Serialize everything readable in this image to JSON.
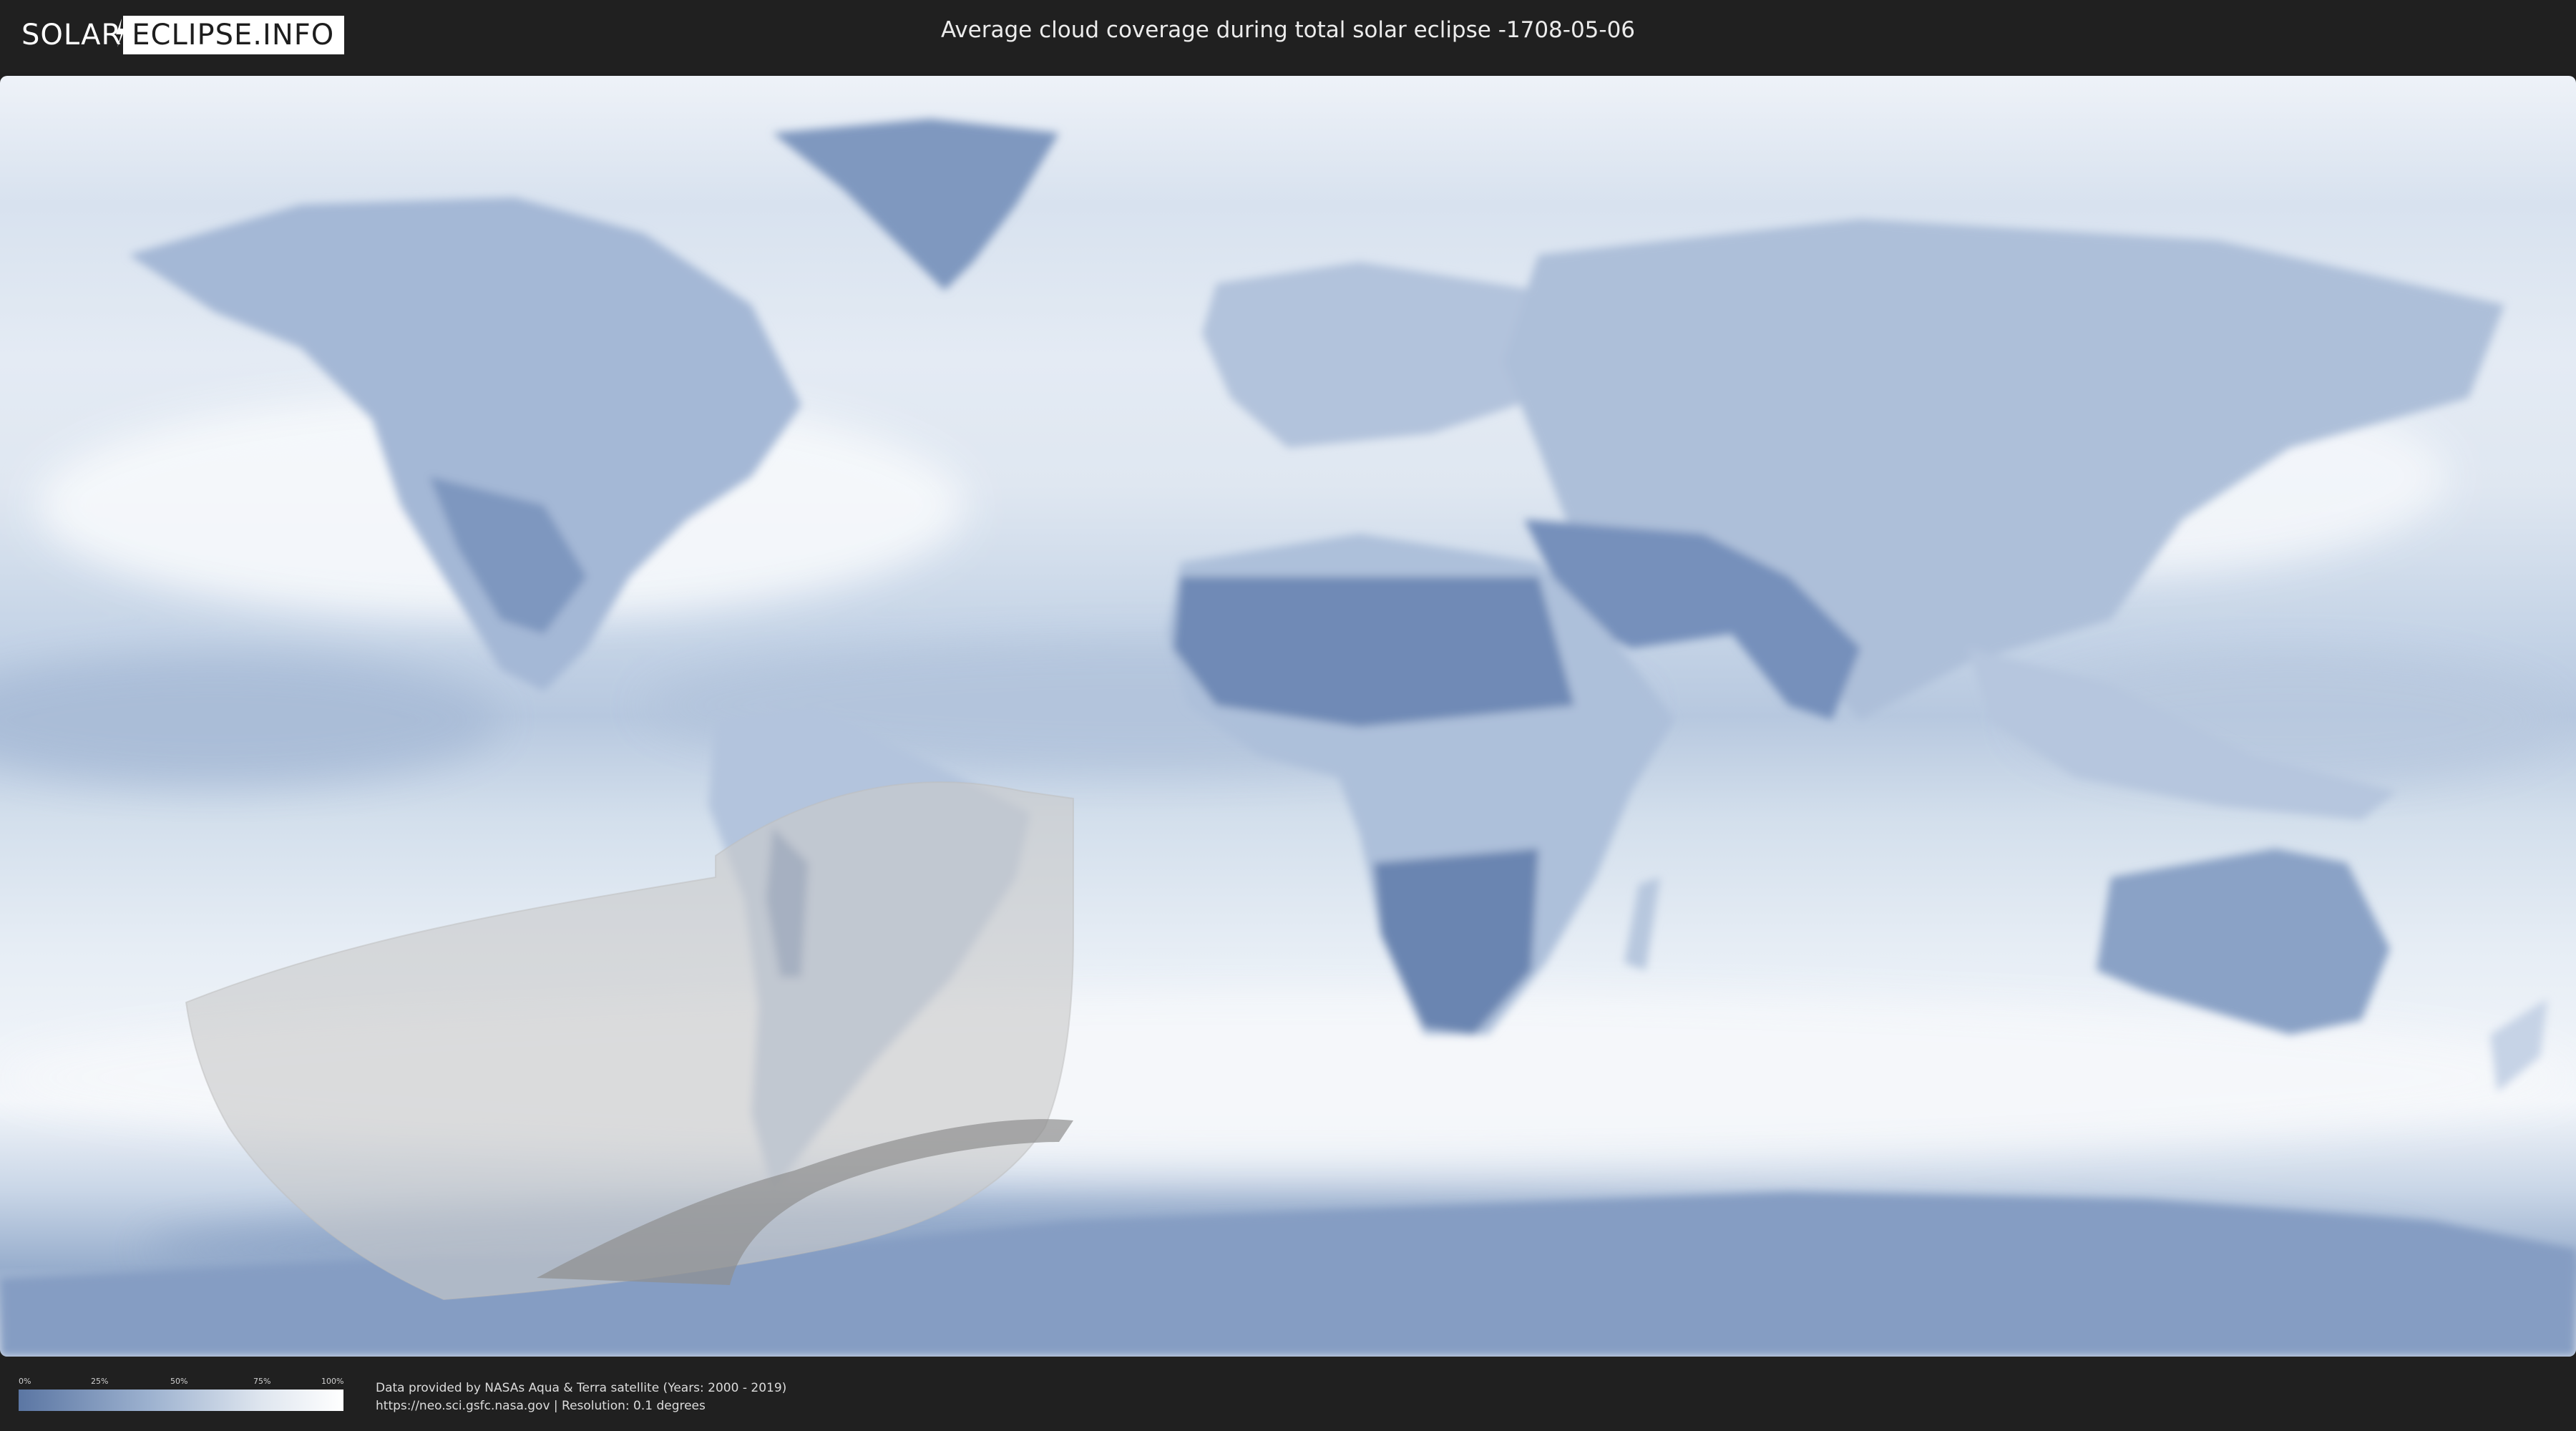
{
  "header": {
    "logo_part1": "SOLAR",
    "logo_part2": "ECLIPSE.INFO",
    "title": "Average cloud coverage during total solar eclipse -1708-05-06"
  },
  "legend": {
    "ticks": [
      "0%",
      "25%",
      "50%",
      "75%",
      "100%"
    ],
    "colors": {
      "low": "#5b76a3",
      "high": "#ffffff"
    }
  },
  "credits": {
    "line1": "Data provided by NASAs Aqua & Terra satellite (Years: 2000 - 2019)",
    "line2": "https://neo.sci.gsfc.nasa.gov | Resolution: 0.1 degrees"
  },
  "colors": {
    "background": "#202020",
    "cloud_clear": "#6e89b3",
    "cloud_full": "#f4f7fb",
    "eclipse_zone": "#c9c9c9",
    "totality_path": "#8f8f8f"
  }
}
